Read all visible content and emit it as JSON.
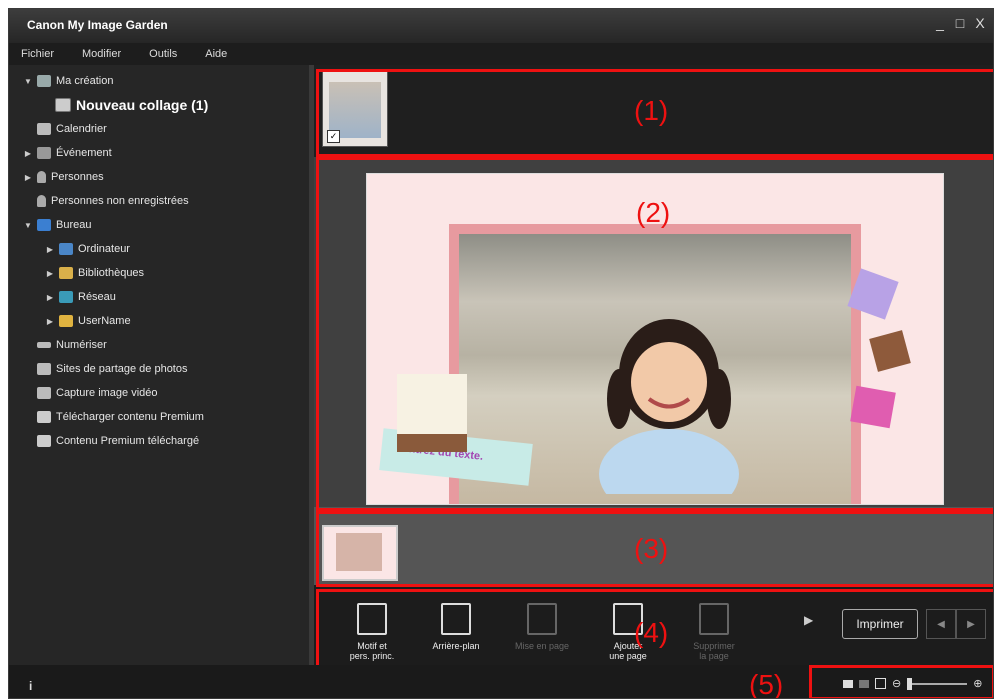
{
  "window": {
    "title": "Canon My Image Garden",
    "controls": [
      "_",
      "□",
      "X"
    ]
  },
  "menu": [
    "Fichier",
    "Modifier",
    "Outils",
    "Aide"
  ],
  "sidebar": {
    "items": [
      {
        "label": "Ma création",
        "arrow": "▼",
        "icon": "creation-icon"
      },
      {
        "label": "Nouveau collage (1)",
        "icon": "collage-icon"
      },
      {
        "label": "Calendrier",
        "icon": "calendar-icon"
      },
      {
        "label": "Événement",
        "arrow": "▶",
        "icon": "event-icon"
      },
      {
        "label": "Personnes",
        "arrow": "▶",
        "icon": "person-icon"
      },
      {
        "label": "Personnes non enregistrées",
        "icon": "person-unregistered-icon"
      },
      {
        "label": "Bureau",
        "arrow": "▼",
        "icon": "desktop-icon"
      },
      {
        "label": "Ordinateur",
        "arrow": "▶",
        "icon": "computer-icon"
      },
      {
        "label": "Bibliothèques",
        "arrow": "▶",
        "icon": "libraries-icon"
      },
      {
        "label": "Réseau",
        "arrow": "▶",
        "icon": "network-icon"
      },
      {
        "label": "UserName",
        "arrow": "▶",
        "icon": "user-folder-icon"
      },
      {
        "label": "Numériser",
        "icon": "scan-icon"
      },
      {
        "label": "Sites de partage de photos",
        "icon": "photo-share-icon"
      },
      {
        "label": "Capture image vidéo",
        "icon": "video-capture-icon"
      },
      {
        "label": "Télécharger contenu Premium",
        "icon": "download-premium-icon"
      },
      {
        "label": "Contenu Premium téléchargé",
        "icon": "premium-folder-icon"
      }
    ]
  },
  "callouts": [
    "(1)",
    "(2)",
    "(3)",
    "(4)",
    "(5)"
  ],
  "editor": {
    "text_placeholder": "Entrez du texte."
  },
  "toolbar": {
    "motif": "Motif et\npers. princ.",
    "background": "Arrière-plan",
    "layout": "Mise en page",
    "add_page": "Ajouter\nune page",
    "delete_page": "Supprimer\nla page",
    "print": "Imprimer"
  },
  "status": {
    "info": "i",
    "zoom_minus": "⊖",
    "zoom_plus": "⊕"
  },
  "colors": {
    "highlight": "#ee1111",
    "page_bg": "#fbe6e6"
  }
}
